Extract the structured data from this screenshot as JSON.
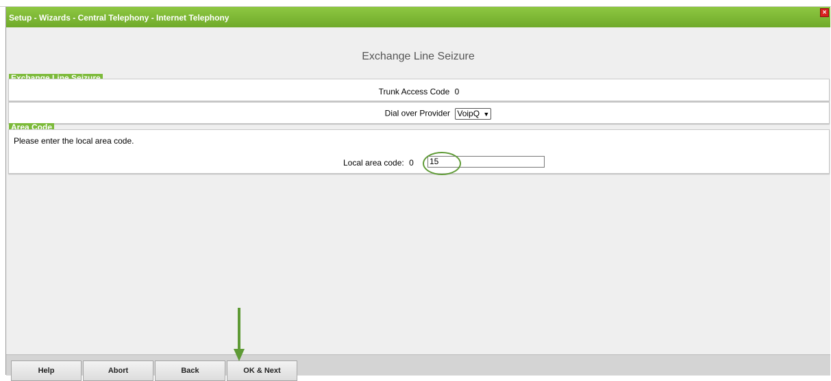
{
  "window": {
    "title": "Setup - Wizards - Central Telephony - Internet Telephony",
    "close_glyph": "×"
  },
  "page": {
    "heading": "Exchange Line Seizure"
  },
  "sections": {
    "exchange": {
      "label": "Exchange Line Seizure",
      "trunk_label": "Trunk Access Code",
      "trunk_value": "0",
      "provider_label": "Dial over Provider",
      "provider_selected": "VoipQ"
    },
    "area": {
      "label": "Area Code",
      "instruction": "Please enter the local area code.",
      "local_label": "Local area code:",
      "prefix": "0",
      "value": "15"
    }
  },
  "buttons": {
    "help": "Help",
    "abort": "Abort",
    "back": "Back",
    "ok_next": "OK & Next"
  },
  "colors": {
    "accent_green": "#7cba3a",
    "close_red": "#d92020",
    "annotation_green": "#5e9a35"
  },
  "icons": {
    "close": "close-icon",
    "dropdown": "chevron-down-icon",
    "annotation": "arrow-down-icon"
  }
}
